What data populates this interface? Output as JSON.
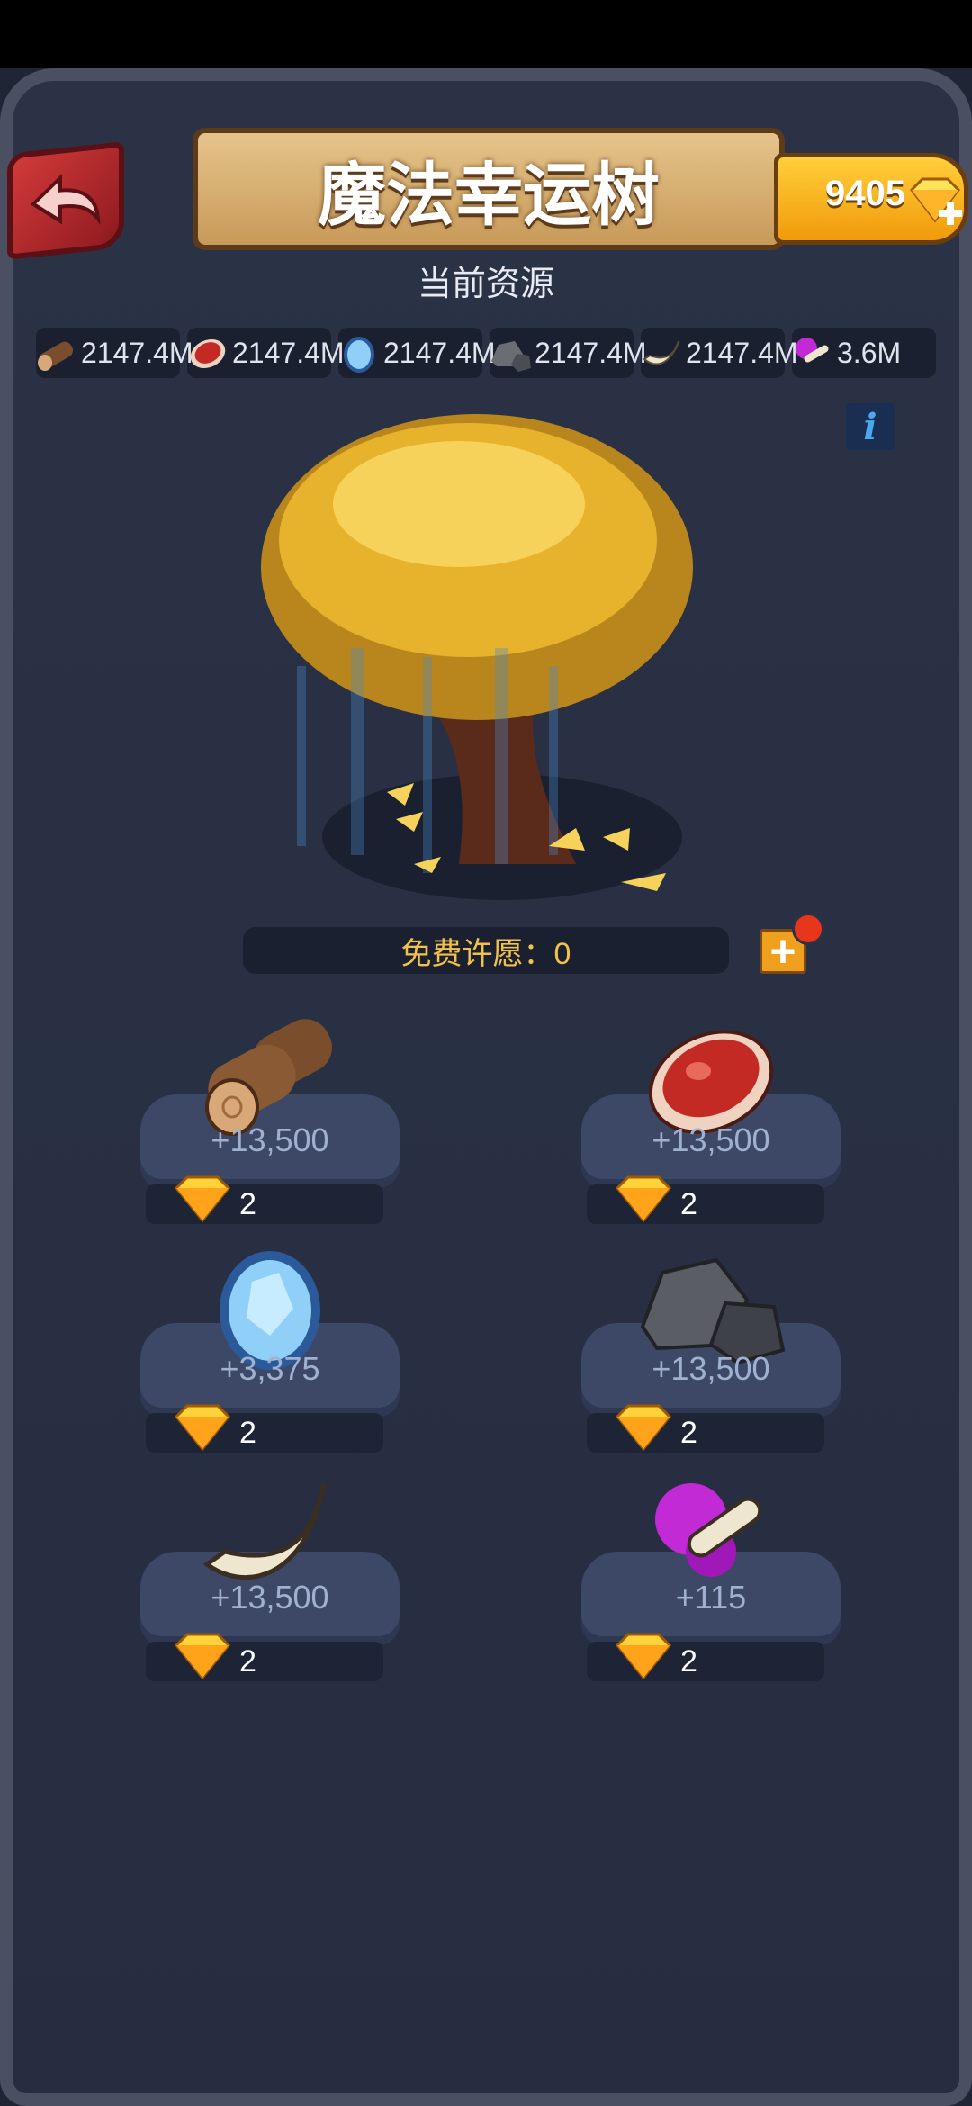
{
  "header": {
    "title": "魔法幸运树",
    "gems": "9405",
    "subtitle": "当前资源"
  },
  "resources": [
    {
      "icon": "wood-icon",
      "value": "2147.4M"
    },
    {
      "icon": "meat-icon",
      "value": "2147.4M"
    },
    {
      "icon": "crystal-icon",
      "value": "2147.4M"
    },
    {
      "icon": "stone-icon",
      "value": "2147.4M"
    },
    {
      "icon": "bone-icon",
      "value": "2147.4M"
    },
    {
      "icon": "cursed-bone-icon",
      "value": "3.6M"
    }
  ],
  "wish": {
    "label": "免费许愿：0"
  },
  "items": [
    {
      "icon": "wood-icon",
      "amount": "+13,500",
      "cost": "2"
    },
    {
      "icon": "meat-icon",
      "amount": "+13,500",
      "cost": "2"
    },
    {
      "icon": "crystal-icon",
      "amount": "+3,375",
      "cost": "2"
    },
    {
      "icon": "stone-icon",
      "amount": "+13,500",
      "cost": "2"
    },
    {
      "icon": "bone-icon",
      "amount": "+13,500",
      "cost": "2"
    },
    {
      "icon": "cursed-bone-icon",
      "amount": "+115",
      "cost": "2"
    }
  ],
  "colors": {
    "gold": "#f2c24a",
    "panel": "#2b3246",
    "accent_red": "#d23a3a"
  }
}
